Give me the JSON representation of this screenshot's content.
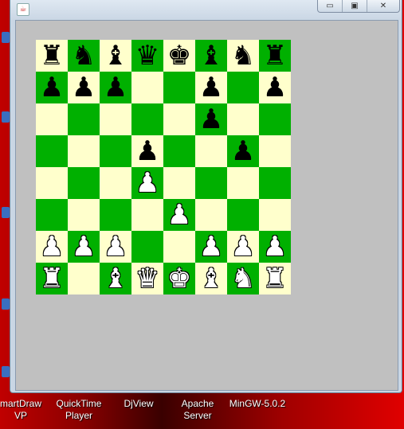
{
  "window": {
    "controls": {
      "minimize": "▭",
      "maximize": "▣",
      "close": "✕"
    },
    "app_icon": "java-icon"
  },
  "colors": {
    "light_square": "#ffffcc",
    "dark_square": "#00b000",
    "background": "#c0c0c0"
  },
  "board": {
    "orientation": "white-bottom",
    "ranks": [
      [
        "r",
        "n",
        "b",
        "q",
        "k",
        "b",
        "n",
        "r"
      ],
      [
        "p",
        "p",
        "p",
        "",
        "",
        "p",
        "",
        "p"
      ],
      [
        "",
        "",
        "",
        "",
        "",
        "p",
        "",
        ""
      ],
      [
        "",
        "",
        "",
        "p",
        "",
        "",
        "p",
        ""
      ],
      [
        "",
        "",
        "",
        "P",
        "",
        "",
        "",
        ""
      ],
      [
        "",
        "",
        "",
        "",
        "P",
        "",
        "",
        ""
      ],
      [
        "P",
        "P",
        "P",
        "",
        "",
        "P",
        "P",
        "P"
      ],
      [
        "R",
        "",
        "B",
        "Q",
        "K",
        "B",
        "N",
        "R"
      ]
    ]
  },
  "desktop": {
    "shortcuts": [
      {
        "label1": "martDraw",
        "label2": "VP"
      },
      {
        "label1": "QuickTime",
        "label2": "Player"
      },
      {
        "label1": "DjView",
        "label2": ""
      },
      {
        "label1": "Apache",
        "label2": "Server"
      },
      {
        "label1": "MinGW-5.0.2",
        "label2": ""
      }
    ]
  }
}
